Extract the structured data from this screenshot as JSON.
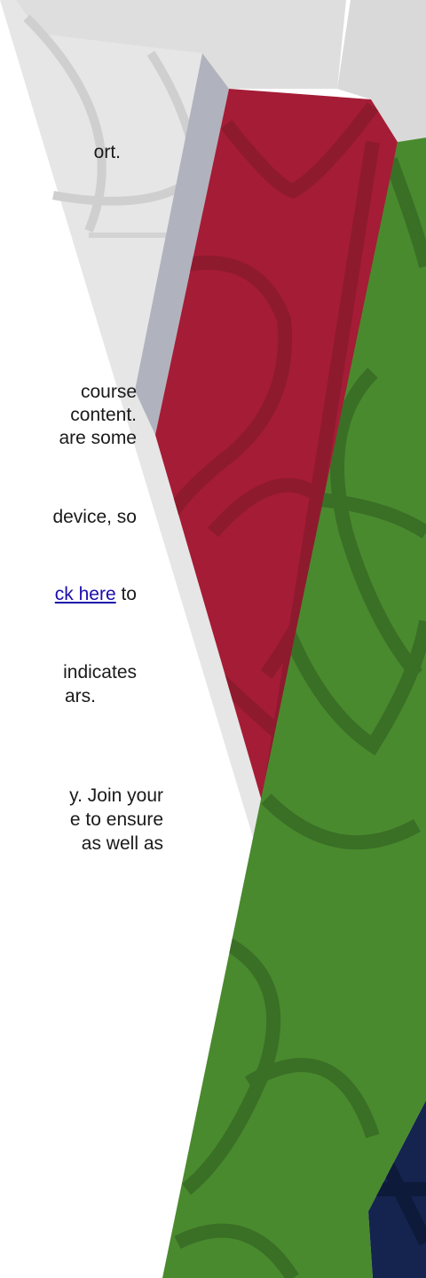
{
  "colors": {
    "red_band": "#a51c36",
    "green_band": "#4a8a2e",
    "navy_band": "#14244e",
    "silver_fold": "#b0b3bd",
    "pale_grey": "#dcdcdc"
  },
  "decoration": {
    "icon": "leaf-pattern-bands"
  },
  "text_lines": [
    {
      "text": "ort.",
      "link": "",
      "tail": ""
    },
    {
      "text": "course",
      "link": "",
      "tail": ""
    },
    {
      "text": "content.",
      "link": "",
      "tail": ""
    },
    {
      "text": "are some",
      "link": "",
      "tail": ""
    },
    {
      "text": "device, so",
      "link": "",
      "tail": ""
    },
    {
      "text": "",
      "link": "ck here",
      "tail": " to"
    },
    {
      "text": "indicates",
      "link": "",
      "tail": ""
    },
    {
      "text": "ars.",
      "link": "",
      "tail": ""
    },
    {
      "text": "y. Join your",
      "link": "",
      "tail": ""
    },
    {
      "text": "e to ensure",
      "link": "",
      "tail": ""
    },
    {
      "text": "as well as",
      "link": "",
      "tail": ""
    }
  ]
}
